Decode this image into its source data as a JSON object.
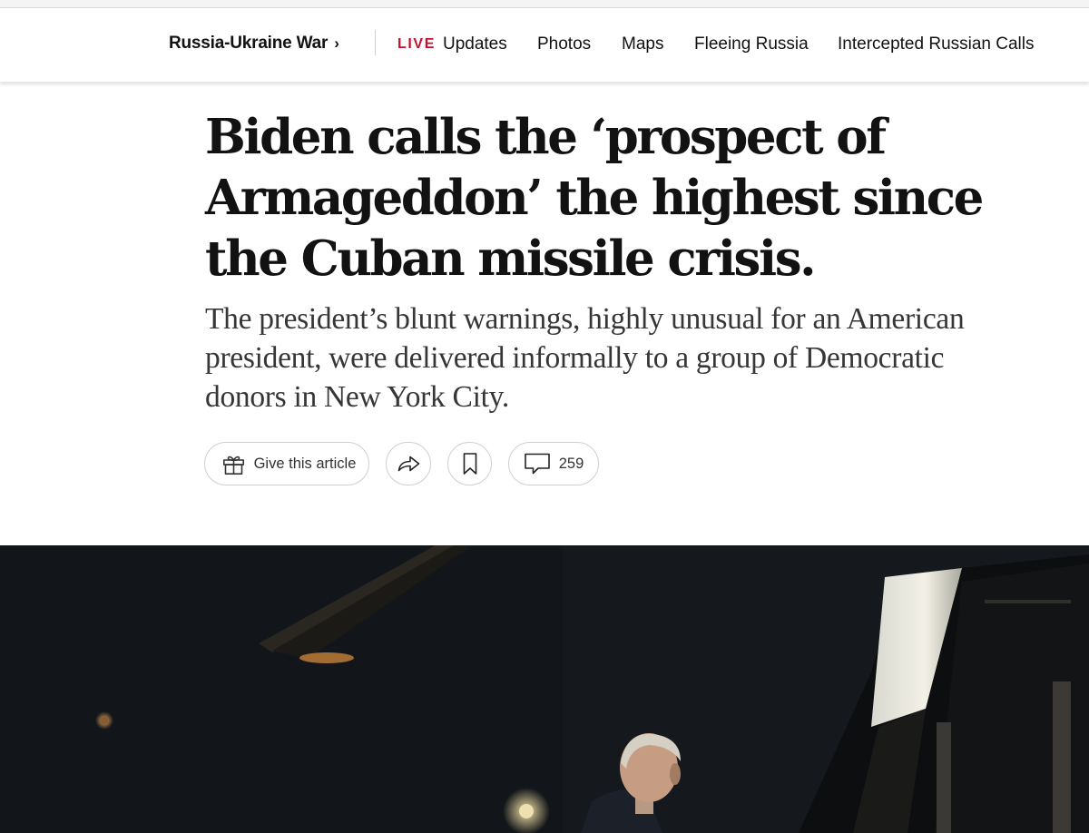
{
  "nav": {
    "section_label": "Russia-Ukraine War",
    "chevron": "›",
    "live_label": "LIVE",
    "links": [
      "Updates",
      "Photos",
      "Maps",
      "Fleeing Russia",
      "Intercepted Russian Calls"
    ]
  },
  "article": {
    "headline": "Biden calls the ‘prospect of Armageddon’ the highest since the Cuban missile crisis.",
    "summary": "The president’s blunt warnings, highly unusual for an American president, were delivered informally to a group of Democratic donors in New York City."
  },
  "actions": {
    "gift_label": "Give this article",
    "gift_icon": "gift-icon",
    "share_icon": "share-icon",
    "save_icon": "bookmark-icon",
    "comment_icon": "comment-icon",
    "comments_count": "259"
  },
  "colors": {
    "live": "#c8102e",
    "text": "#121212",
    "summary_text": "#363636",
    "pill_border": "#cfcfcf",
    "photo_background": "#15181c"
  }
}
